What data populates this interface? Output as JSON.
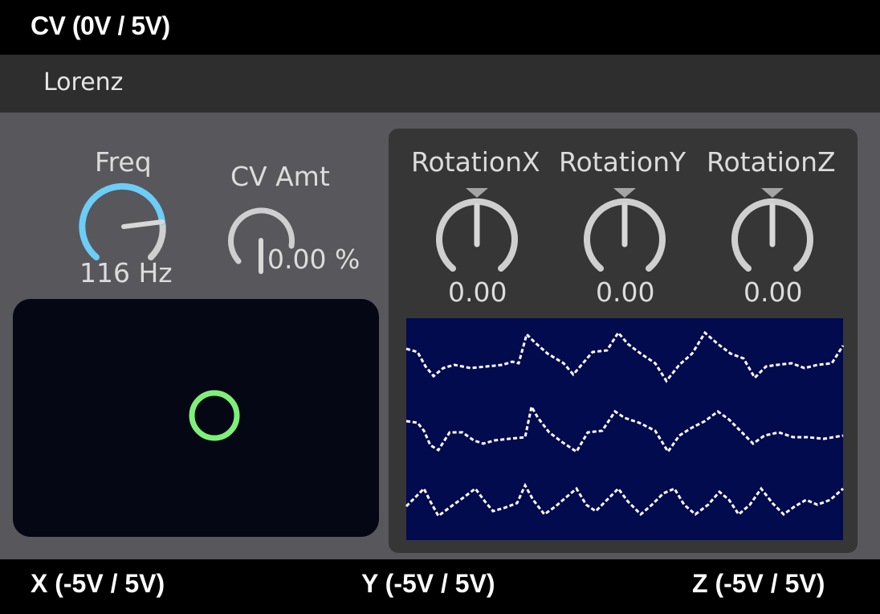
{
  "header": {
    "cv_input_label": "CV (0V / 5V)"
  },
  "title": {
    "label": "Lorenz"
  },
  "controls": {
    "freq": {
      "label": "Freq",
      "value": "116 Hz",
      "color": "#6ccdf7"
    },
    "cv_amt": {
      "label": "CV Amt",
      "value": "0.00 %"
    }
  },
  "rotation": {
    "x": {
      "label": "RotationX",
      "value": "0.00"
    },
    "y": {
      "label": "RotationY",
      "value": "0.00"
    },
    "z": {
      "label": "RotationZ",
      "value": "0.00"
    }
  },
  "xy_pad": {
    "indicator_color": "#7ef07a",
    "background": "#050714"
  },
  "scope": {
    "background": "#020b4e",
    "trace_color": "#ffffff"
  },
  "outputs": {
    "x": "X (-5V / 5V)",
    "y": "Y (-5V / 5V)",
    "z": "Z (-5V / 5V)"
  }
}
